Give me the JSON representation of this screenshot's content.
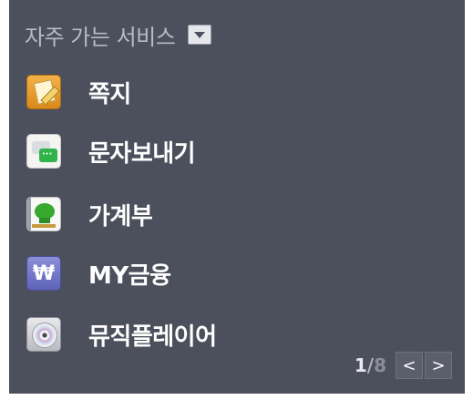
{
  "header": {
    "title": "자주 가는 서비스",
    "dropdown_icon": "triangle-down-icon"
  },
  "services": [
    {
      "label": "쪽지",
      "icon": "note-pen-icon"
    },
    {
      "label": "문자보내기",
      "icon": "sms-bubble-icon"
    },
    {
      "label": "가계부",
      "icon": "account-book-icon"
    },
    {
      "label": "MY금융",
      "icon": "won-currency-icon"
    },
    {
      "label": "뮤직플레이어",
      "icon": "music-cd-icon"
    }
  ],
  "pagination": {
    "current": "1",
    "separator": "/",
    "total": "8",
    "prev_label": "<",
    "next_label": ">"
  },
  "colors": {
    "panel_bg": "#4c4f5c",
    "label_text": "#ffffff",
    "header_text": "#b8bbc6"
  }
}
